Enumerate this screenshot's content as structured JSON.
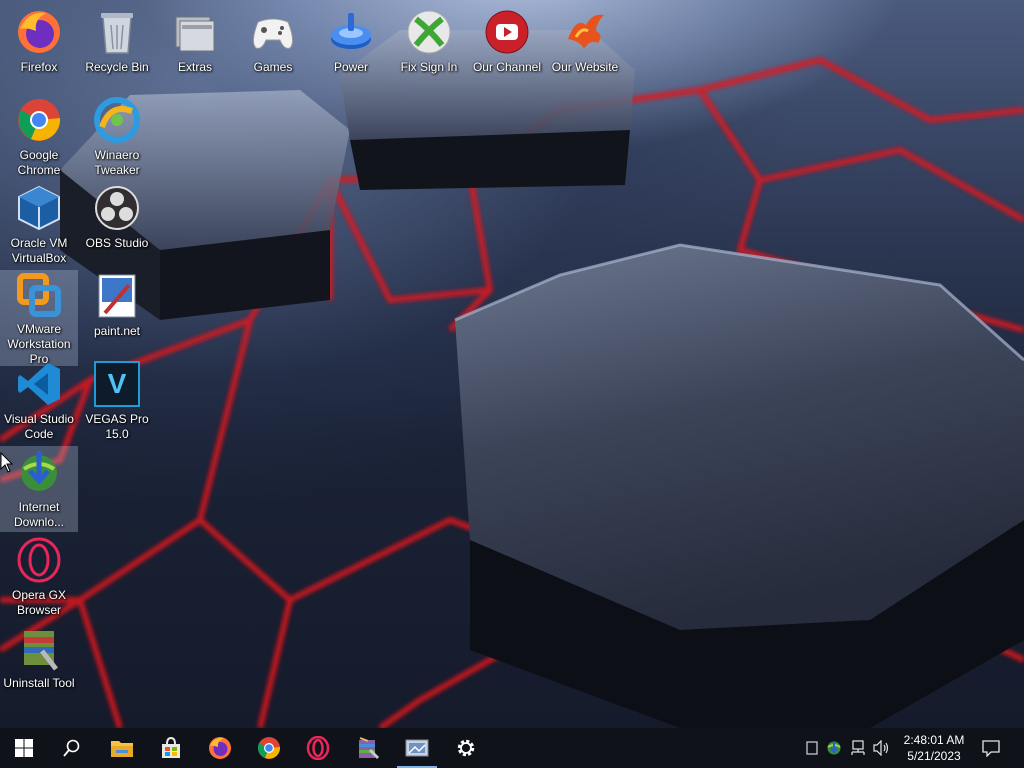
{
  "desktop": {
    "icons": [
      {
        "label": "Firefox",
        "icon": "firefox-icon"
      },
      {
        "label": "Recycle Bin",
        "icon": "recycle-bin-icon"
      },
      {
        "label": "Extras",
        "icon": "folder-icon"
      },
      {
        "label": "Games",
        "icon": "gamepad-icon"
      },
      {
        "label": "Power",
        "icon": "power-icon"
      },
      {
        "label": "Fix Sign In",
        "icon": "xbox-icon"
      },
      {
        "label": "Our Channel",
        "icon": "youtube-icon"
      },
      {
        "label": "Our Website",
        "icon": "phoenix-icon"
      },
      {
        "label": "Google Chrome",
        "icon": "chrome-icon"
      },
      {
        "label": "Winaero Tweaker",
        "icon": "winaero-icon"
      },
      {
        "label": "Oracle VM VirtualBox",
        "icon": "virtualbox-icon"
      },
      {
        "label": "OBS Studio",
        "icon": "obs-icon"
      },
      {
        "label": "VMware Workstation Pro",
        "icon": "vmware-icon"
      },
      {
        "label": "paint.net",
        "icon": "paintnet-icon"
      },
      {
        "label": "Visual Studio Code",
        "icon": "vscode-icon"
      },
      {
        "label": "VEGAS Pro 15.0",
        "icon": "vegas-icon",
        "glyph_text": "V"
      },
      {
        "label": "Internet Downlo...",
        "icon": "idm-icon"
      },
      {
        "label": "Opera GX Browser",
        "icon": "opera-gx-icon"
      },
      {
        "label": "Uninstall Tool",
        "icon": "uninstall-tool-icon"
      }
    ]
  },
  "taskbar": {
    "buttons": [
      {
        "name": "start-button",
        "icon": "windows-icon"
      },
      {
        "name": "search-button",
        "icon": "search-icon"
      },
      {
        "name": "file-explorer-button",
        "icon": "folder-icon"
      },
      {
        "name": "store-button",
        "icon": "store-icon"
      },
      {
        "name": "firefox-button",
        "icon": "firefox-icon"
      },
      {
        "name": "chrome-button",
        "icon": "chrome-icon"
      },
      {
        "name": "opera-button",
        "icon": "opera-icon"
      },
      {
        "name": "winrar-button",
        "icon": "archive-icon"
      },
      {
        "name": "screenshot-app-button",
        "icon": "screenshot-icon"
      },
      {
        "name": "settings-button",
        "icon": "gear-icon"
      }
    ],
    "tray": {
      "time": "2:48:01 AM",
      "date": "5/21/2023"
    }
  },
  "colors": {
    "taskbar_bg": "#0f1219",
    "accent": "#7fb2e8",
    "wallpaper_red": "#e0121c"
  }
}
